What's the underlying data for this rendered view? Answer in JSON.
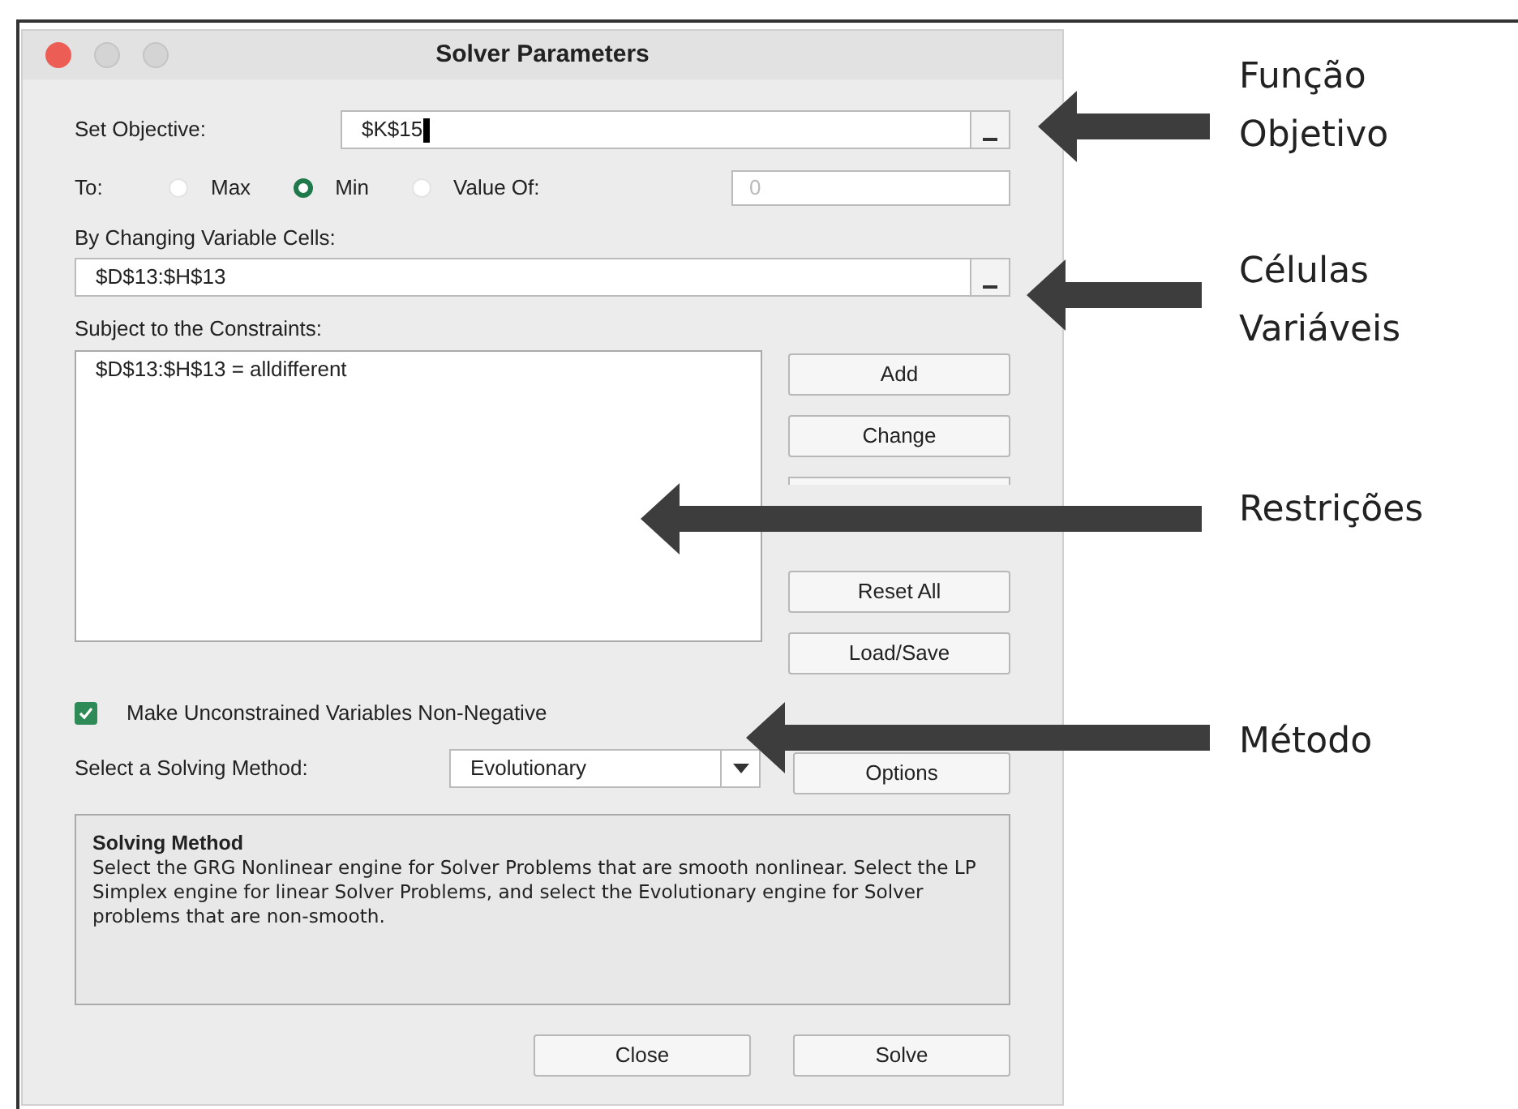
{
  "window": {
    "title": "Solver Parameters"
  },
  "objective": {
    "label": "Set Objective:",
    "value": "$K$15"
  },
  "to": {
    "label": "To:",
    "options": [
      {
        "label": "Max",
        "selected": false
      },
      {
        "label": "Min",
        "selected": true
      },
      {
        "label": "Value Of:",
        "selected": false
      }
    ],
    "value_of": {
      "value": "0",
      "disabled": true
    }
  },
  "variable_cells": {
    "label": "By Changing Variable Cells:",
    "value": "$D$13:$H$13"
  },
  "constraints": {
    "label": "Subject to the Constraints:",
    "items": [
      "$D$13:$H$13 = alldifferent"
    ],
    "buttons": [
      "Add",
      "Change",
      "Reset All",
      "Load/Save"
    ]
  },
  "non_negative": {
    "label": "Make Unconstrained Variables Non-Negative",
    "checked": true
  },
  "solving_method": {
    "label": "Select a Solving Method:",
    "value": "Evolutionary",
    "options_button": "Options"
  },
  "method_info": {
    "title": "Solving Method",
    "text": "Select the GRG Nonlinear engine for Solver Problems that are smooth nonlinear. Select the LP Simplex engine for linear Solver Problems, and select the Evolutionary engine for Solver problems that are non-smooth."
  },
  "footer_buttons": [
    "Close",
    "Solve"
  ],
  "annotations": [
    {
      "lines": [
        "Função",
        "Objetivo"
      ]
    },
    {
      "lines": [
        "Células",
        "Variáveis"
      ]
    },
    {
      "lines": [
        "Restrições"
      ]
    },
    {
      "lines": [
        "Método"
      ]
    }
  ]
}
